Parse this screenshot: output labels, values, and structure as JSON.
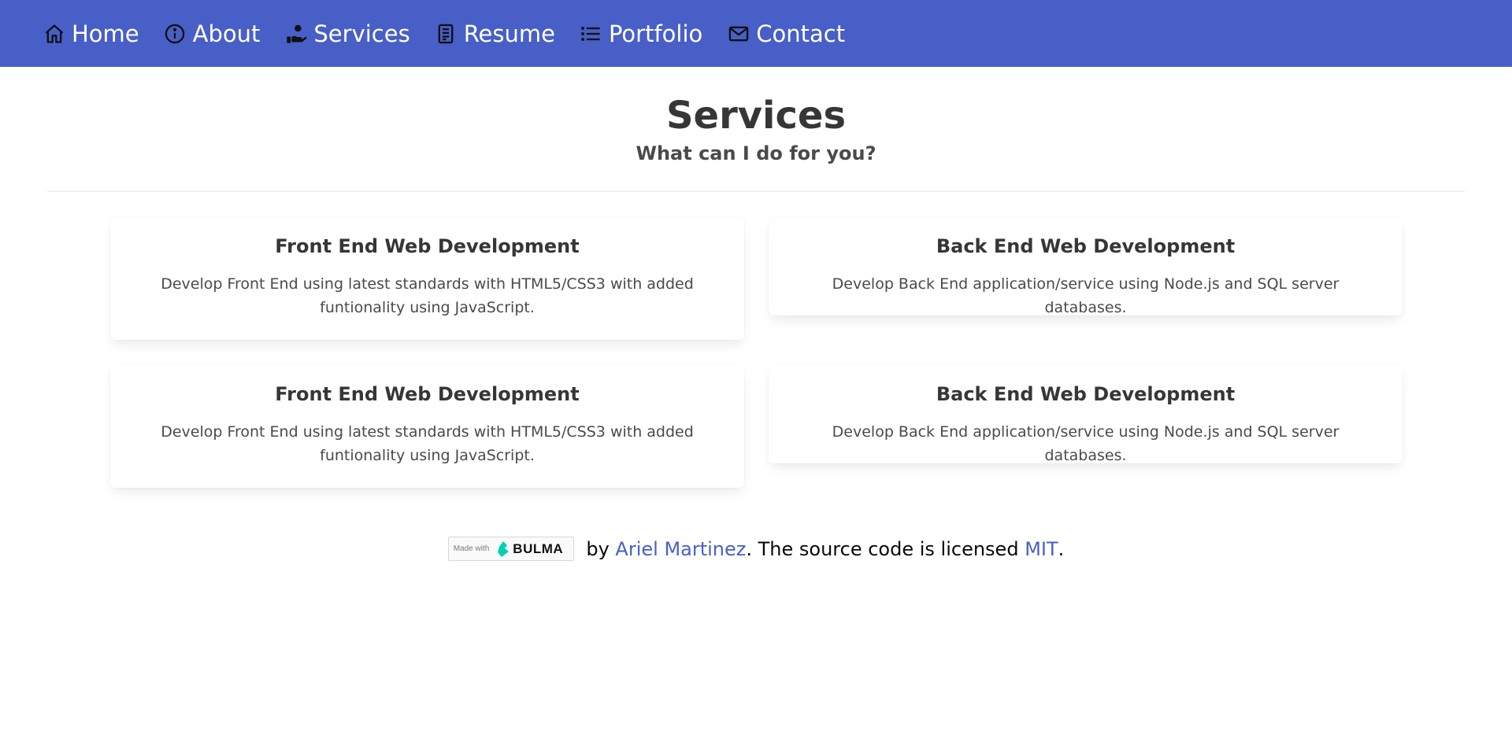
{
  "nav": {
    "items": [
      {
        "label": "Home",
        "icon": "home-icon"
      },
      {
        "label": "About",
        "icon": "info-icon"
      },
      {
        "label": "Services",
        "icon": "hand-service-icon"
      },
      {
        "label": "Resume",
        "icon": "document-icon"
      },
      {
        "label": "Portfolio",
        "icon": "list-icon"
      },
      {
        "label": "Contact",
        "icon": "mail-icon"
      }
    ],
    "background": "#485fc7"
  },
  "hero": {
    "title": "Services",
    "subtitle": "What can I do for you?"
  },
  "cards": [
    {
      "title": "Front End Web Development",
      "text": "Develop Front End using latest standards with HTML5/CSS3 with added funtionality using JavaScript."
    },
    {
      "title": "Back End Web Development",
      "text": "Develop Back End application/service using Node.js and SQL server databases."
    },
    {
      "title": "Front End Web Development",
      "text": "Develop Front End using latest standards with HTML5/CSS3 with added funtionality using JavaScript."
    },
    {
      "title": "Back End Web Development",
      "text": "Develop Back End application/service using Node.js and SQL server databases."
    }
  ],
  "footer": {
    "badge_made": "Made with",
    "badge_brand": "BULMA",
    "by": " by ",
    "author": "Ariel Martinez",
    "middle": ". The source code is licensed ",
    "license": "MIT",
    "end": ".",
    "link_color": "#485fc7",
    "bulma_color": "#00d1b2"
  }
}
